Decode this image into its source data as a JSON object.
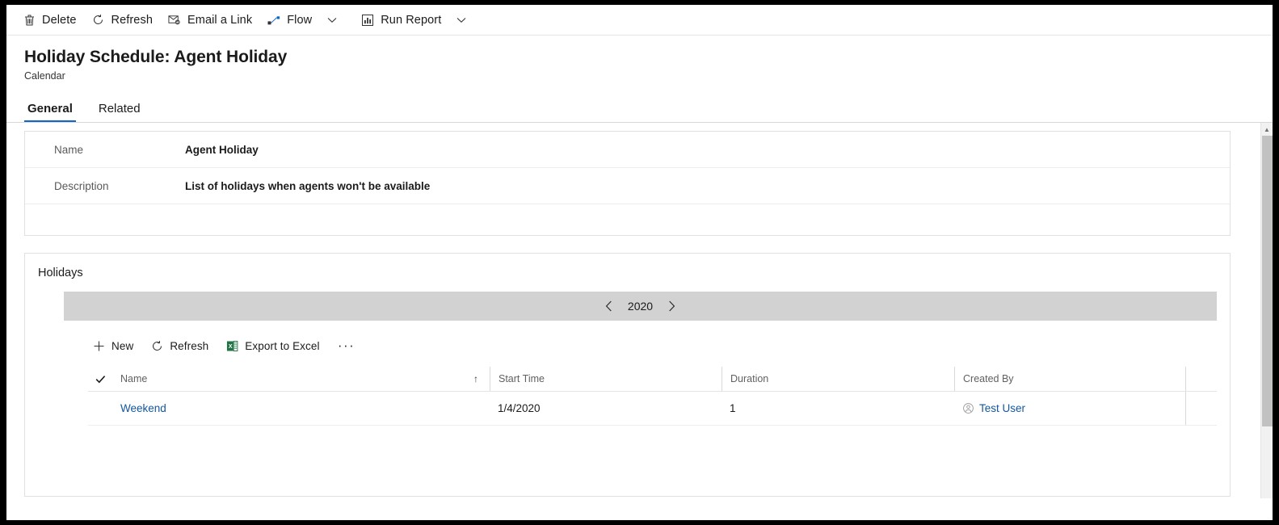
{
  "theme": {
    "accent": "#1266c8",
    "link": "#12569e",
    "year_bar_bg": "#d2d2d2"
  },
  "command_bar": {
    "items": [
      {
        "label": "Delete",
        "icon": "trash-icon",
        "has_dropdown": false
      },
      {
        "label": "Refresh",
        "icon": "refresh-icon",
        "has_dropdown": false
      },
      {
        "label": "Email a Link",
        "icon": "email-link-icon",
        "has_dropdown": false
      },
      {
        "label": "Flow",
        "icon": "flow-icon",
        "has_dropdown": true
      },
      {
        "label": "Run Report",
        "icon": "run-report-icon",
        "has_dropdown": true
      }
    ]
  },
  "header": {
    "title": "Holiday Schedule: Agent Holiday",
    "subtitle": "Calendar",
    "tabs": [
      {
        "label": "General",
        "active": true
      },
      {
        "label": "Related",
        "active": false
      }
    ]
  },
  "general_card": {
    "fields": [
      {
        "label": "Name",
        "value": "Agent Holiday"
      },
      {
        "label": "Description",
        "value": "List of holidays when agents won't be available"
      }
    ]
  },
  "holidays": {
    "section_title": "Holidays",
    "year_nav": {
      "prev_icon": "chevron-left-icon",
      "year": "2020",
      "next_icon": "chevron-right-icon"
    },
    "subgrid_commands": [
      {
        "label": "New",
        "icon": "plus-icon"
      },
      {
        "label": "Refresh",
        "icon": "refresh-icon"
      },
      {
        "label": "Export to Excel",
        "icon": "excel-icon"
      }
    ],
    "overflow_label": "···",
    "grid": {
      "select_all_icon": "checkmark-icon",
      "columns": [
        {
          "label": "Name",
          "sorted": true,
          "sort_icon": "↑"
        },
        {
          "label": "Start Time",
          "sorted": false
        },
        {
          "label": "Duration",
          "sorted": false
        },
        {
          "label": "Created By",
          "sorted": false
        }
      ],
      "rows": [
        {
          "name": "Weekend",
          "start_time": "1/4/2020",
          "duration": "1",
          "created_by": "Test User",
          "created_by_icon": "person-avatar-icon"
        }
      ]
    }
  },
  "scrollbar": {
    "up_icon": "▲",
    "down_icon": "▼"
  }
}
